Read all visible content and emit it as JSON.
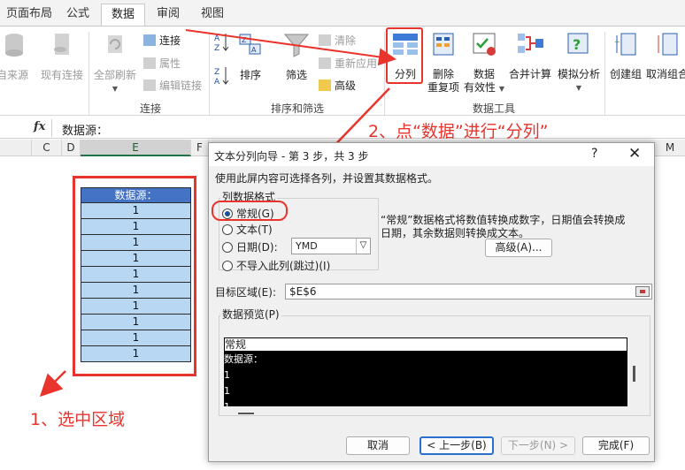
{
  "tabs": [
    "页面布局",
    "公式",
    "数据",
    "审阅",
    "视图"
  ],
  "active_tab": "数据",
  "ribbon": {
    "get_data": {
      "from_source": "自来源",
      "existing_conn": "现有连接"
    },
    "connections": {
      "refresh_all": "全部刷新",
      "connections": "连接",
      "properties": "属性",
      "edit_links": "编辑链接",
      "group_label": "连接"
    },
    "sort_filter": {
      "sort": "排序",
      "filter": "筛选",
      "clear": "清除",
      "reapply": "重新应用",
      "advanced": "高级",
      "group_label": "排序和筛选"
    },
    "data_tools": {
      "text_to_columns": "分列",
      "remove_dup_1": "删除",
      "remove_dup_2": "重复项",
      "validation_1": "数据",
      "validation_2": "有效性",
      "consolidate": "合并计算",
      "what_if": "模拟分析",
      "group_label": "数据工具"
    },
    "outline": {
      "group": "创建组",
      "ungroup": "取消组合"
    }
  },
  "formula_bar": {
    "fx": "fx",
    "value": "数据源："
  },
  "columns": [
    "C",
    "D",
    "E",
    "F",
    "M"
  ],
  "sheet": {
    "header": "数据源：",
    "values": [
      "1",
      "1",
      "1",
      "1",
      "1",
      "1",
      "1",
      "1",
      "1",
      "1"
    ]
  },
  "annotations": {
    "step1": "1、选中区域",
    "step2": "2、点“数据”进行“分列”"
  },
  "dialog": {
    "title": "文本分列向导 - 第 3 步，共 3 步",
    "help": "?",
    "close": "✕",
    "instruction": "使用此屏内容可选择各列，并设置其数据格式。",
    "format_group": "列数据格式",
    "options": [
      "常规(G)",
      "文本(T)",
      "日期(D):",
      "不导入此列(跳过)(I)"
    ],
    "selected_option": 0,
    "date_format": "YMD",
    "description_1": "“常规”数据格式将数值转换成数字，日期值会转换成",
    "description_2": "日期，其余数据则转换成文本。",
    "advanced_btn": "高级(A)...",
    "dest_label": "目标区域(E):",
    "dest_value": "$E$6",
    "preview_label": "数据预览(P)",
    "preview_header": "常规",
    "preview_rows": [
      "数据源：",
      "1",
      "1",
      "1"
    ],
    "buttons": {
      "cancel": "取消",
      "back": "< 上一步(B)",
      "next": "下一步(N) >",
      "finish": "完成(F)"
    }
  },
  "colors": {
    "accent_red": "#e8342c",
    "header_blue": "#4472c4",
    "cell_blue": "#b7d7f2",
    "excel_green": "#217346"
  }
}
